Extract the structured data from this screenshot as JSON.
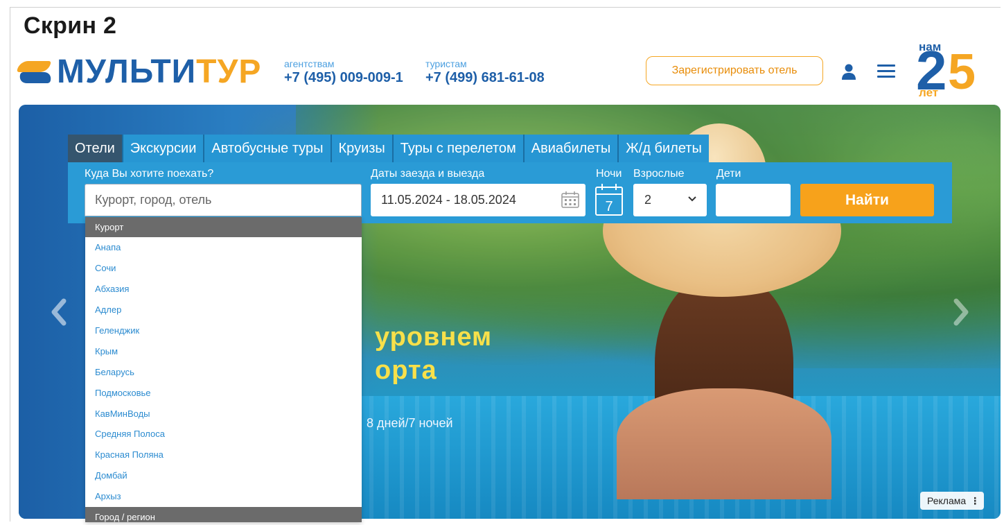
{
  "caption": "Скрин 2",
  "header": {
    "logo_part1": "МУЛЬТИ",
    "logo_part2": "ТУР",
    "agents_caption": "агентствам",
    "agents_phone": "+7 (495) 009-009-1",
    "tourists_caption": "туристам",
    "tourists_phone": "+7 (499) 681-61-08",
    "register_label": "Зарегистрировать отель",
    "anniversary": {
      "top": "нам",
      "num1": "2",
      "num2": "5",
      "bottom": "лет"
    }
  },
  "search": {
    "tabs": [
      "Отели",
      "Экскурсии",
      "Автобусные туры",
      "Круизы",
      "Туры с перелетом",
      "Авиабилеты",
      "Ж/д билеты"
    ],
    "active_tab": "Отели",
    "destination_label": "Куда Вы хотите поехать?",
    "destination_placeholder": "Курорт, город, отель",
    "dates_label": "Даты заезда и выезда",
    "dates_value": "11.05.2024 - 18.05.2024",
    "nights_label": "Ночи",
    "nights_value": "7",
    "adults_label": "Взрослые",
    "adults_value": "2",
    "children_label": "Дети",
    "children_value": "",
    "find_label": "Найти"
  },
  "dropdown": {
    "group1": "Курорт",
    "items": [
      "Анапа",
      "Сочи",
      "Абхазия",
      "Адлер",
      "Геленджик",
      "Крым",
      "Беларусь",
      "Подмосковье",
      "КавМинВоды",
      "Средняя Полоса",
      "Красная Поляна",
      "Домбай",
      "Архыз"
    ],
    "group2": "Город / регион"
  },
  "banner": {
    "line1": "уровнем",
    "line2": "орта",
    "line3": "8 дней/7 ночей",
    "ad_label": "Реклама",
    "ad_menu": "⋮"
  },
  "colors": {
    "brand_blue": "#1e5fa8",
    "brand_orange": "#f5a623",
    "panel_blue": "#2a9bd6",
    "active_tab": "#35556e"
  }
}
